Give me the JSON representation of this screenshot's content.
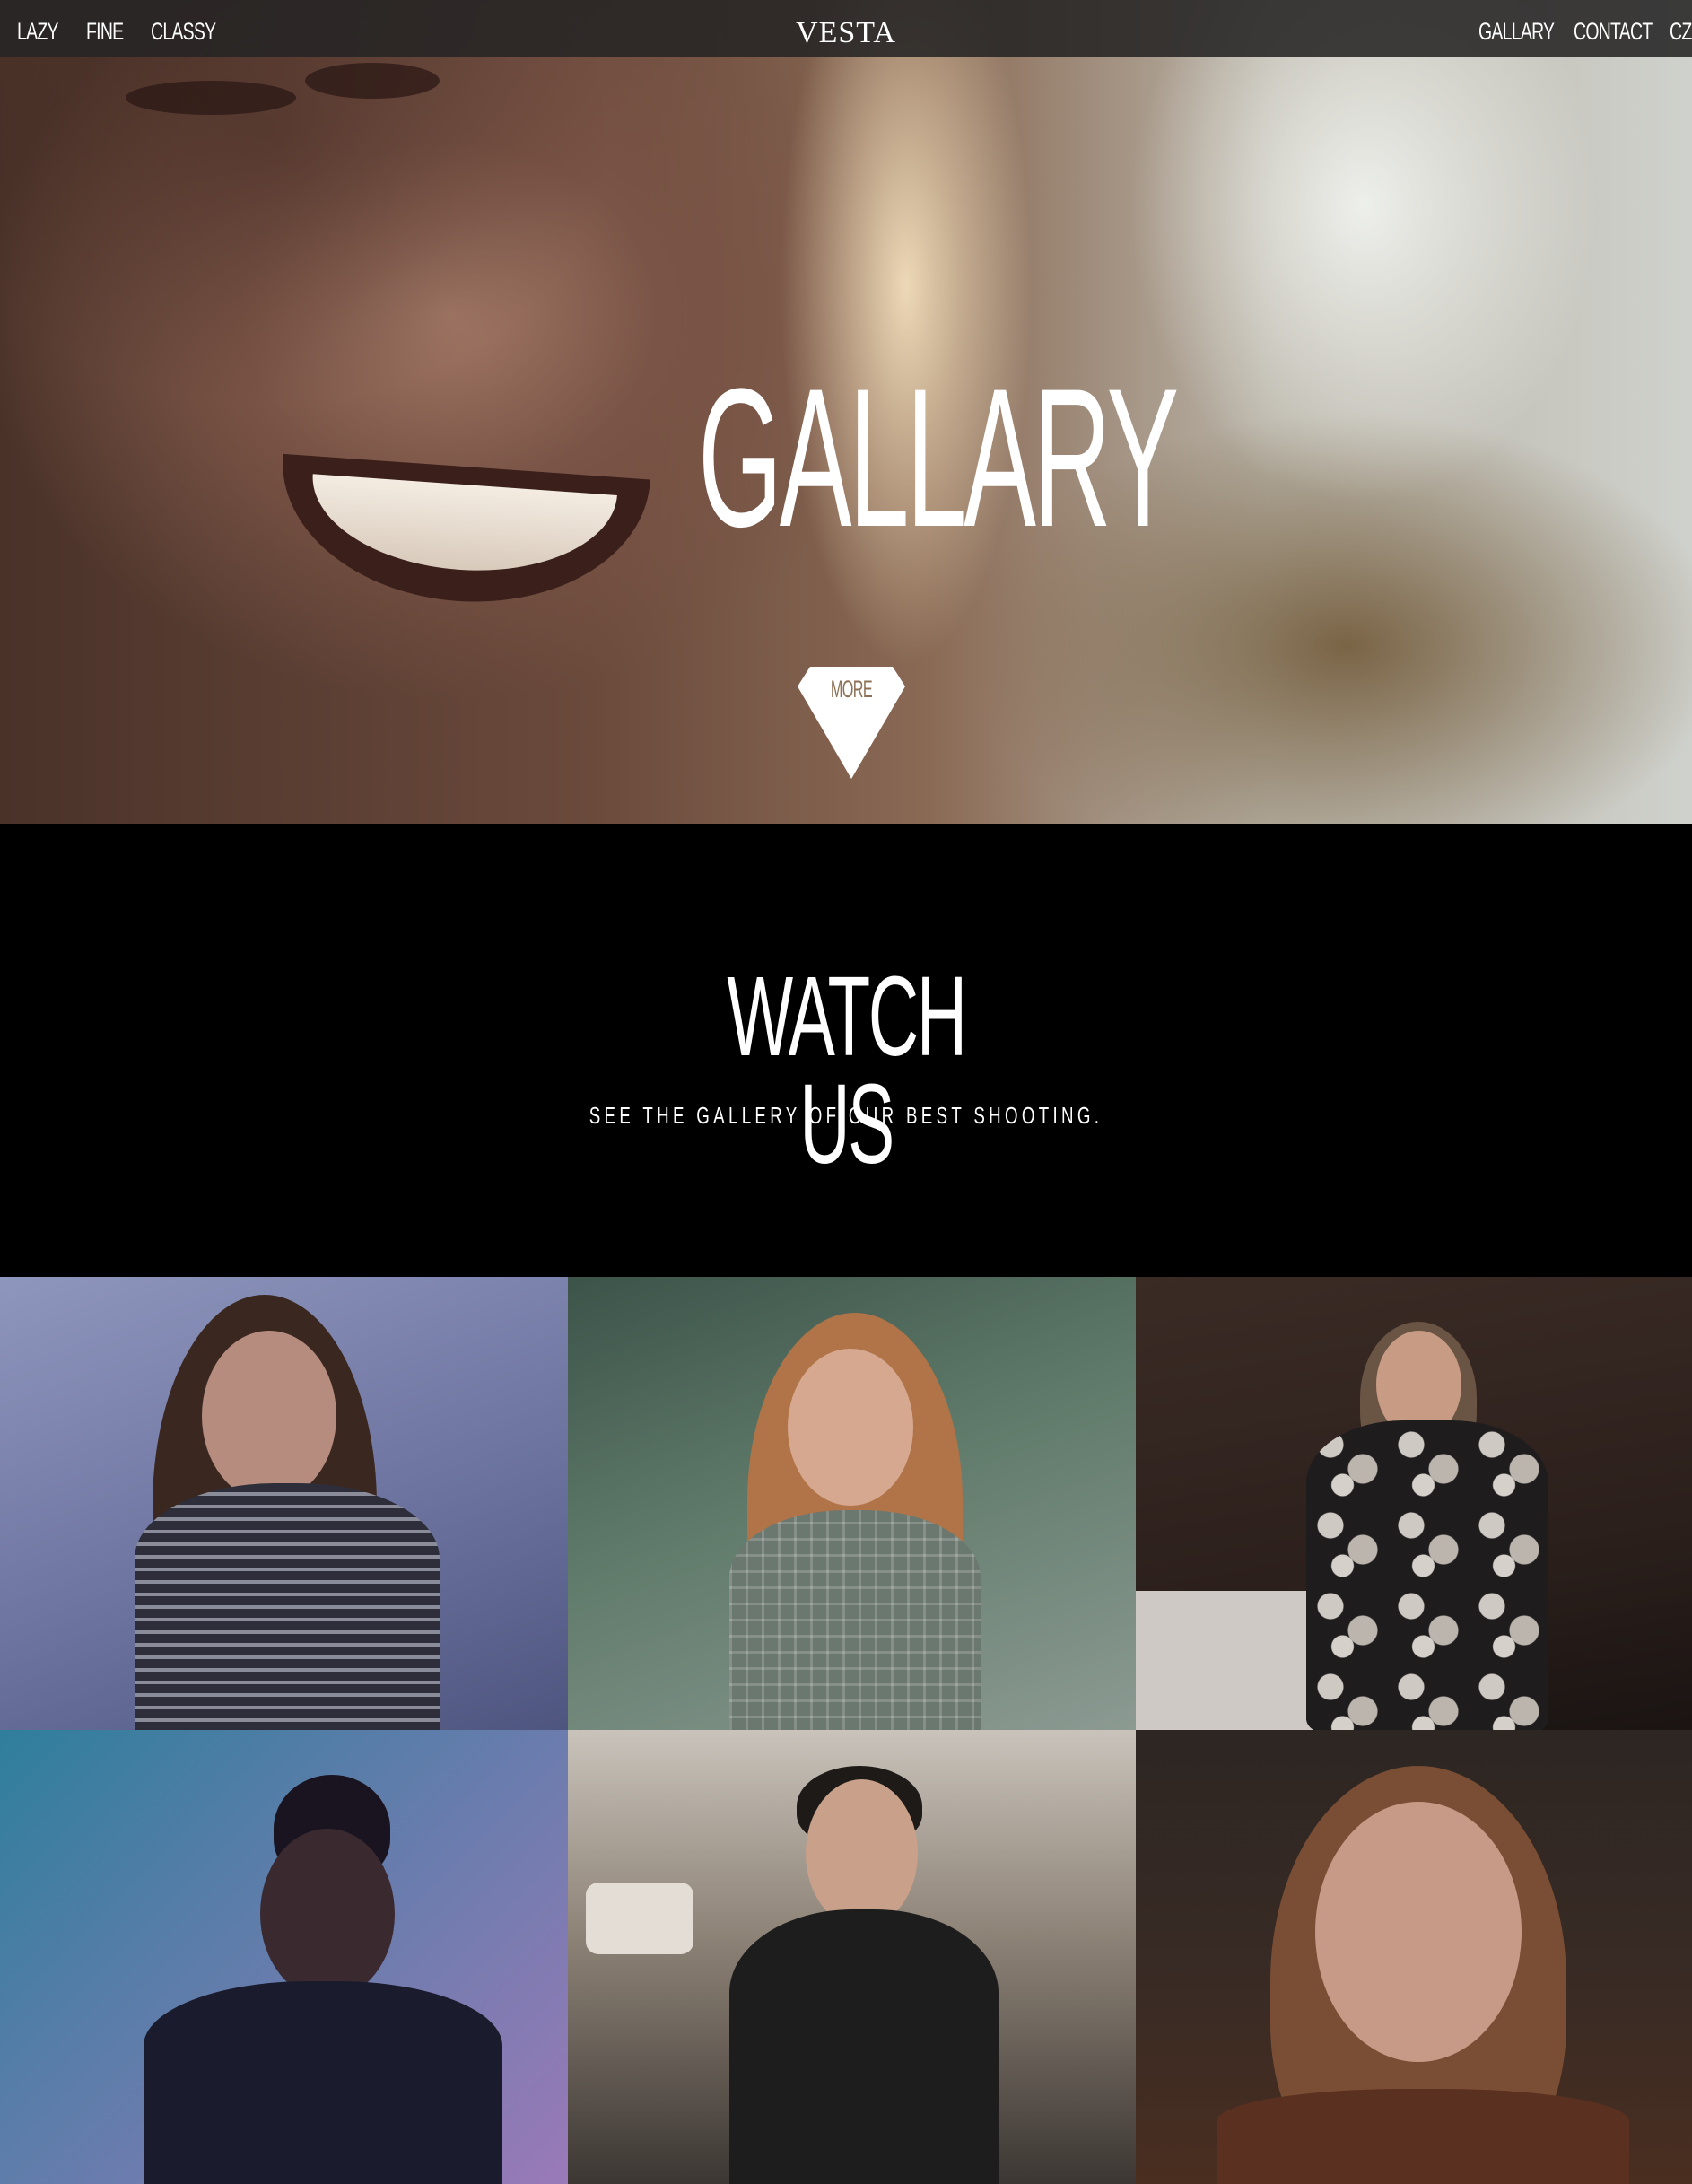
{
  "nav": {
    "left_links": [
      "LAZY",
      "FINE",
      "CLASSY"
    ],
    "brand": "VESTA",
    "right_links": [
      "GALLARY",
      "CONTACT",
      "CZ"
    ]
  },
  "hero": {
    "title": "GALLARY",
    "more_label": "MORE"
  },
  "watch": {
    "title": "WATCH US",
    "subtitle": "SEE THE GALLERY OF OUR BEST SHOOTING."
  },
  "gallery": {
    "photos": [
      {
        "subject": "woman-striped-top"
      },
      {
        "subject": "girl-plaid-dress"
      },
      {
        "subject": "woman-floral-dress"
      },
      {
        "subject": "woman-neon-backdrop"
      },
      {
        "subject": "man-leather-jacket"
      },
      {
        "subject": "woman-portrait"
      }
    ]
  },
  "colors": {
    "nav_bg": "#262424",
    "more_text": "#8c7155",
    "section_bg": "#000000",
    "text": "#ffffff"
  }
}
